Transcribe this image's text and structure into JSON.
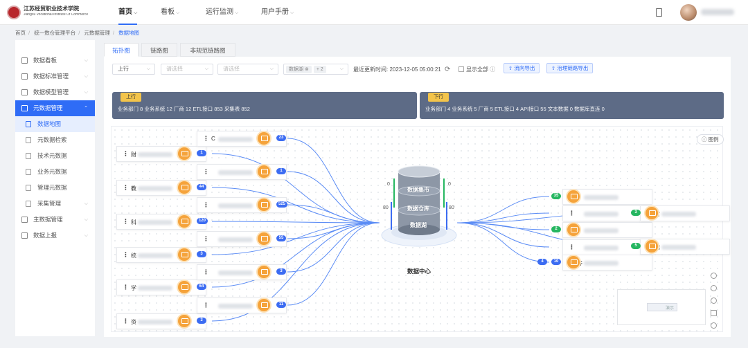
{
  "header": {
    "logo_cn": "江苏经贸职业技术学院",
    "logo_en": "Jiangsu Vocational Institute Of Commerce",
    "nav": [
      {
        "label": "首页",
        "active": true
      },
      {
        "label": "看板",
        "active": false
      },
      {
        "label": "运行监测",
        "active": false
      },
      {
        "label": "用户手册",
        "active": false
      }
    ]
  },
  "breadcrumb": [
    "首页",
    "统一数仓管理平台",
    "元数据管理",
    "数据地图"
  ],
  "sidebar": {
    "items": [
      {
        "label": "数据看板",
        "has_arrow": true,
        "active": false
      },
      {
        "label": "数据标准管理",
        "has_arrow": true,
        "active": false
      },
      {
        "label": "数据模型管理",
        "has_arrow": true,
        "active": false
      },
      {
        "label": "元数据管理",
        "has_arrow": true,
        "active": true
      },
      {
        "label": "数据地图",
        "sub": true,
        "active": true
      },
      {
        "label": "元数据检索",
        "sub": true,
        "active": false
      },
      {
        "label": "技术元数据",
        "sub": true,
        "active": false
      },
      {
        "label": "业务元数据",
        "sub": true,
        "active": false
      },
      {
        "label": "管理元数据",
        "sub": true,
        "active": false
      },
      {
        "label": "采集管理",
        "sub": true,
        "has_arrow": true,
        "active": false
      },
      {
        "label": "主数据管理",
        "has_arrow": true,
        "active": false
      },
      {
        "label": "数据上报",
        "has_arrow": true,
        "active": false
      }
    ]
  },
  "tabs": [
    {
      "label": "拓扑图",
      "active": true
    },
    {
      "label": "链路图",
      "active": false
    },
    {
      "label": "非规范链路图",
      "active": false
    }
  ],
  "filters": {
    "direction": "上行",
    "select1_placeholder": "请选择",
    "select2_placeholder": "请选择",
    "select3_placeholder": "请选择",
    "multi_tag": "数据湖",
    "multi_more": "+ 2",
    "updated": "最近更新时间: 2023-12-05 05:00:21",
    "show_all": "显示全部",
    "export_flow": "流向导出",
    "export_governance": "治理链路导出"
  },
  "upstream": {
    "tag": "上行",
    "stats": "业务部门 8   业务系统 12   厂商 12   ETL接口 853   采集表 852"
  },
  "downstream": {
    "tag": "下行",
    "stats": "业务部门 4   业务系统 5   厂商 5   ETL接口 4   API接口 55   文本数据 0   数据库直连 0"
  },
  "graph": {
    "center": {
      "label": "数据中心",
      "layers": [
        "数据集市",
        "数据仓库",
        "数据湖"
      ],
      "in_left_top": "0",
      "in_left_bottom": "80",
      "out_right_top": "0",
      "out_right_bottom": "80"
    },
    "left_outer": [
      {
        "prefix": "财",
        "count": "1"
      },
      {
        "prefix": "教",
        "count": "44"
      },
      {
        "prefix": "科",
        "count": "120"
      },
      {
        "prefix": "统",
        "count": "3"
      },
      {
        "prefix": "学",
        "count": "64"
      },
      {
        "prefix": "资",
        "count": "3"
      }
    ],
    "left_inner": [
      {
        "prefix": "C",
        "count": "23"
      },
      {
        "prefix": "",
        "count": "1"
      },
      {
        "prefix": "",
        "count": "525"
      },
      {
        "prefix": "",
        "count": "55"
      },
      {
        "prefix": "",
        "count": "3"
      },
      {
        "prefix": "",
        "count": "11"
      }
    ],
    "right_inner": [
      {
        "prefix": "C",
        "count": "35"
      },
      {
        "prefix": "",
        "count": ""
      },
      {
        "prefix": "J",
        "count": "2"
      },
      {
        "prefix": "",
        "count": ""
      },
      {
        "prefix": "等",
        "count": "10",
        "extra": "4"
      }
    ],
    "right_outer": [
      {
        "prefix": "财",
        "count": "3"
      },
      {
        "prefix": "统",
        "count": "5"
      }
    ],
    "legend": "图例",
    "minimap_text": "演示"
  },
  "colors": {
    "primary": "#2f6cf6",
    "band": "#5d6b86",
    "node_icon": "#f5a33b",
    "pill_blue": "#3c6cf2",
    "pill_green": "#25b660"
  }
}
